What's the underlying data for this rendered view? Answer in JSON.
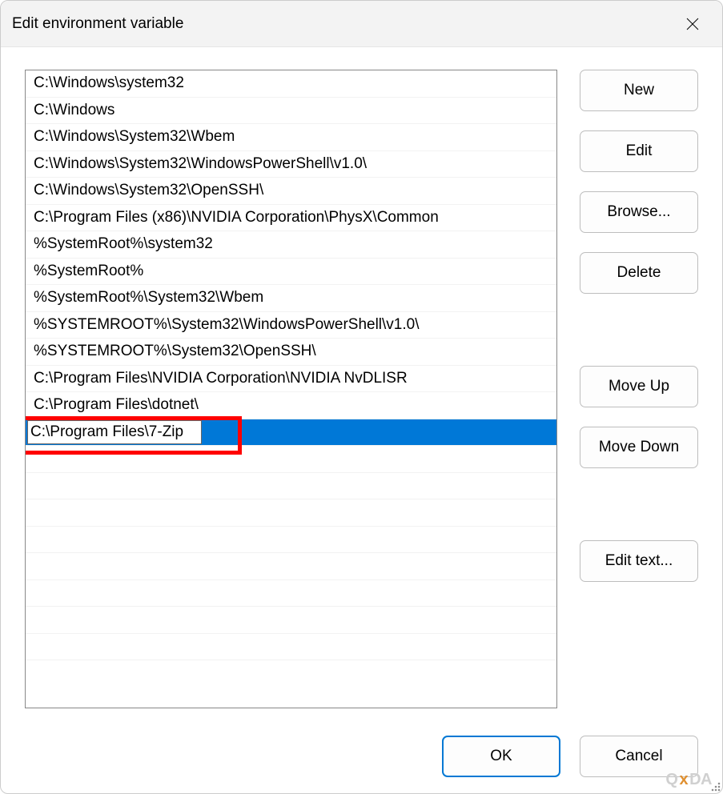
{
  "window": {
    "title": "Edit environment variable"
  },
  "paths": [
    "C:\\Windows\\system32",
    "C:\\Windows",
    "C:\\Windows\\System32\\Wbem",
    "C:\\Windows\\System32\\WindowsPowerShell\\v1.0\\",
    "C:\\Windows\\System32\\OpenSSH\\",
    "C:\\Program Files (x86)\\NVIDIA Corporation\\PhysX\\Common",
    "%SystemRoot%\\system32",
    "%SystemRoot%",
    "%SystemRoot%\\System32\\Wbem",
    "%SYSTEMROOT%\\System32\\WindowsPowerShell\\v1.0\\",
    "%SYSTEMROOT%\\System32\\OpenSSH\\",
    "C:\\Program Files\\NVIDIA Corporation\\NVIDIA NvDLISR",
    "C:\\Program Files\\dotnet\\"
  ],
  "editing": {
    "value": "C:\\Program Files\\7-Zip"
  },
  "buttons": {
    "new": "New",
    "edit": "Edit",
    "browse": "Browse...",
    "delete": "Delete",
    "moveUp": "Move Up",
    "moveDown": "Move Down",
    "editText": "Edit text...",
    "ok": "OK",
    "cancel": "Cancel"
  },
  "watermark": {
    "pre": "Q",
    "x": "x",
    "post": "DA"
  }
}
